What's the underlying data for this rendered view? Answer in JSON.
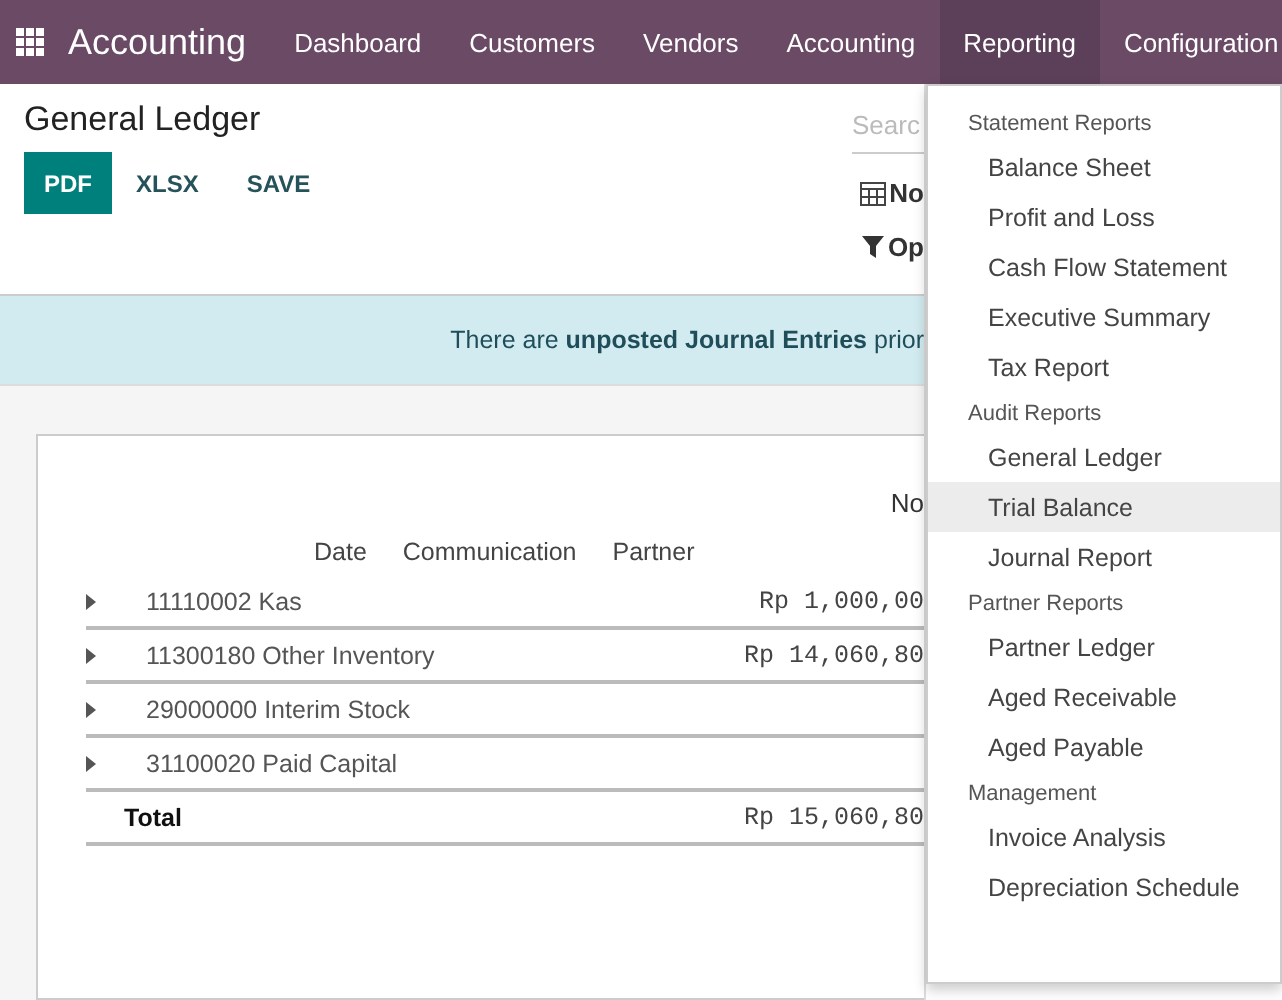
{
  "navbar": {
    "brand": "Accounting",
    "menu": [
      {
        "label": "Dashboard",
        "selected": false
      },
      {
        "label": "Customers",
        "selected": false
      },
      {
        "label": "Vendors",
        "selected": false
      },
      {
        "label": "Accounting",
        "selected": false
      },
      {
        "label": "Reporting",
        "selected": true
      },
      {
        "label": "Configuration",
        "selected": false
      }
    ]
  },
  "control_panel": {
    "title": "General Ledger",
    "buttons": [
      {
        "label": "PDF",
        "primary": true
      },
      {
        "label": "XLSX",
        "primary": false
      },
      {
        "label": "SAVE",
        "primary": false
      }
    ],
    "search": {
      "placeholder": "Searc"
    },
    "date_filter": "No",
    "options_filter": "Op"
  },
  "banner": {
    "text": "There are **unposted Journal Entries** prior"
  },
  "report": {
    "period_header": "No",
    "columns": [
      "Date",
      "Communication",
      "Partner"
    ],
    "rows": [
      {
        "account": "11110002 Kas",
        "amount": "Rp 1,000,00"
      },
      {
        "account": "11300180 Other Inventory",
        "amount": "Rp 14,060,80"
      },
      {
        "account": "29000000 Interim Stock"
      },
      {
        "account": "31100020 Paid Capital"
      }
    ],
    "total": {
      "label": "Total",
      "amount": "Rp 15,060,80"
    }
  },
  "dropdown": {
    "sections": [
      {
        "title": "Statement Reports",
        "items": [
          {
            "label": "Balance Sheet",
            "selected": false
          },
          {
            "label": "Profit and Loss",
            "selected": false
          },
          {
            "label": "Cash Flow Statement",
            "selected": false
          },
          {
            "label": "Executive Summary",
            "selected": false
          },
          {
            "label": "Tax Report",
            "selected": false
          }
        ]
      },
      {
        "title": "Audit Reports",
        "items": [
          {
            "label": "General Ledger",
            "selected": false
          },
          {
            "label": "Trial Balance",
            "selected": true
          },
          {
            "label": "Journal Report",
            "selected": false
          }
        ]
      },
      {
        "title": "Partner Reports",
        "items": [
          {
            "label": "Partner Ledger",
            "selected": false
          },
          {
            "label": "Aged Receivable",
            "selected": false
          },
          {
            "label": "Aged Payable",
            "selected": false
          }
        ]
      },
      {
        "title": "Management",
        "items": [
          {
            "label": "Invoice Analysis",
            "selected": false
          },
          {
            "label": "Depreciation Schedule",
            "selected": false
          }
        ]
      }
    ]
  }
}
